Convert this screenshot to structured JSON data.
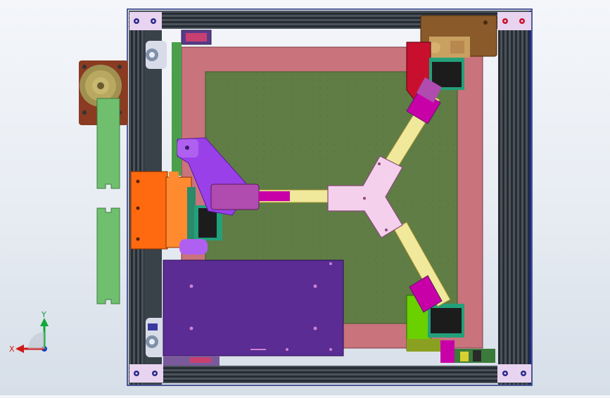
{
  "app": {
    "view": "cad-assembly-top-view"
  },
  "triad": {
    "x_label": "X",
    "y_label": "Y",
    "x_color": "#d01818",
    "y_color": "#12a83c",
    "z_color": "#1840d0"
  },
  "colors": {
    "background_top": "#f4f6fa",
    "background_bottom": "#d6dee8",
    "frame_outline": "#1b2a78",
    "extrusion_dark": "#2c3238",
    "extrusion_mid": "#58626c",
    "corner_bracket": "#e8d4f0",
    "bed_outer": "#c9737c",
    "bed_inner": "#5f7d45",
    "effector": "#f4d0ec",
    "rod": "#f0e89a",
    "carriage_magenta": "#b04cb0",
    "arm_purple": "#9a40e8",
    "control_board": "#5a2c94",
    "left_block_orange": "#ff6a10",
    "stepper_body": "#1c1c1c",
    "stepper_plate": "#23a07a",
    "spool_brown": "#8a3b22",
    "green_strip": "#6fbf6f",
    "bracket_red": "#c8102e",
    "bracket_green": "#6ad000",
    "motor_mount_brown": "#8a5a2a"
  },
  "icons": {
    "triad": "coordinate-axes-icon"
  }
}
